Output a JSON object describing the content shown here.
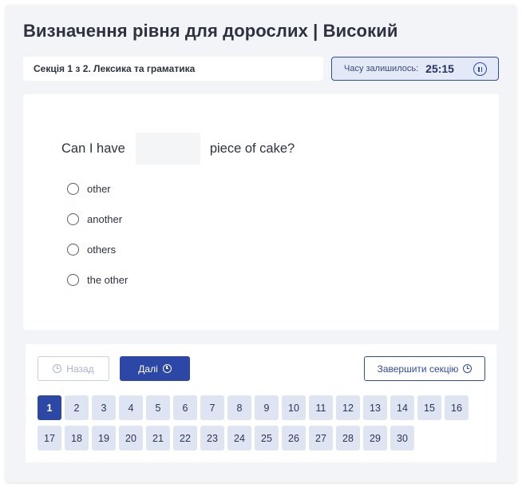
{
  "header": {
    "title": "Визначення рівня для дорослих | Високий",
    "section_label": "Секція 1 з 2. Лексика та граматика"
  },
  "timer": {
    "label": "Часу залишилось:",
    "value": "25:15"
  },
  "question": {
    "before": "Can I have",
    "after": "piece of cake?",
    "options": [
      "other",
      "another",
      "others",
      "the other"
    ]
  },
  "navigation": {
    "back_label": "Назад",
    "next_label": "Далі",
    "finish_label": "Завершити секцію"
  },
  "pages": {
    "current": 1,
    "items": [
      "1",
      "2",
      "3",
      "4",
      "5",
      "6",
      "7",
      "8",
      "9",
      "10",
      "11",
      "12",
      "13",
      "14",
      "15",
      "16",
      "17",
      "18",
      "19",
      "20",
      "21",
      "22",
      "23",
      "24",
      "25",
      "26",
      "27",
      "28",
      "29",
      "30"
    ]
  },
  "colors": {
    "accent": "#2c47a6",
    "page_bg": "#f3f4f8",
    "page_button_bg": "#dfe4f2"
  }
}
